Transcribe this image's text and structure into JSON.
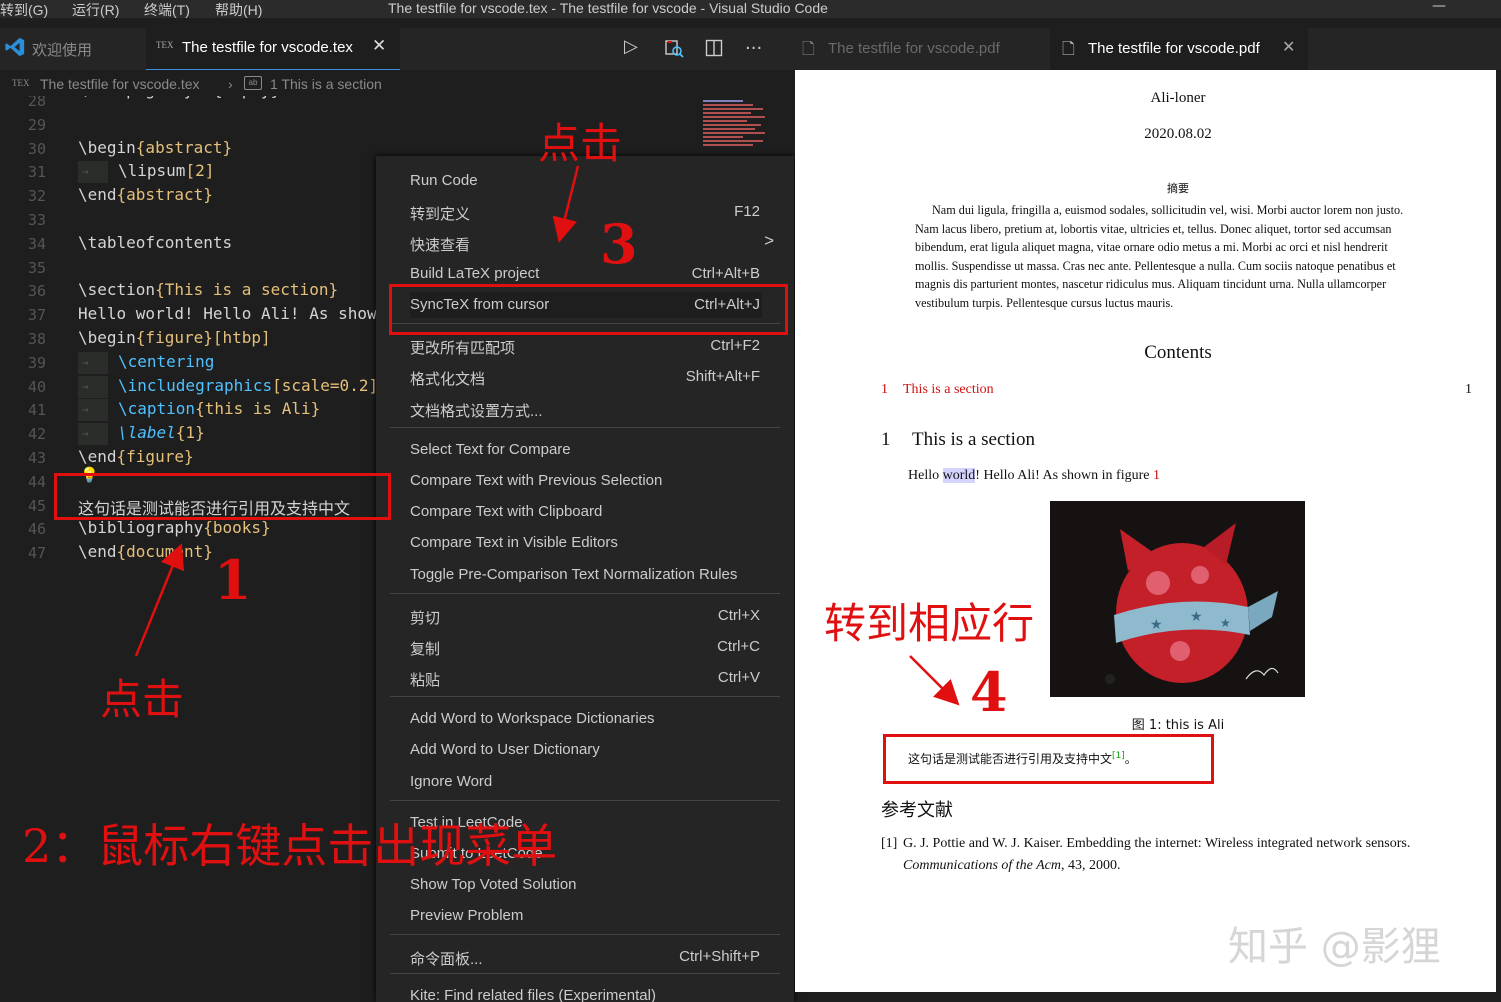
{
  "titlebar": {
    "menus": [
      "转到(G)",
      "运行(R)",
      "终端(T)",
      "帮助(H)"
    ],
    "title": "The testfile for vscode.tex - The testfile for vscode - Visual Studio Code",
    "minimize": "—"
  },
  "editor_tabs": {
    "welcome": "欢迎使用",
    "tex_badge": "TEX",
    "active_tab": "The testfile for vscode.tex",
    "close": "✕",
    "run": "▷",
    "more": "···"
  },
  "breadcrumb": {
    "file": "The testfile for vscode.tex",
    "section": "1 This is a section"
  },
  "code": {
    "lines": [
      {
        "n": "28",
        "text": "\\thispagestyle{empty}"
      },
      {
        "n": "29",
        "text": ""
      },
      {
        "n": "30",
        "cmd": "\\begin",
        "arg": "{abstract}"
      },
      {
        "n": "31",
        "cmd": "\\lipsum",
        "arg": "[2]"
      },
      {
        "n": "32",
        "cmd": "\\end",
        "arg": "{abstract}"
      },
      {
        "n": "33",
        "text": ""
      },
      {
        "n": "34",
        "cmd": "\\tableofcontents",
        "arg": ""
      },
      {
        "n": "35",
        "text": ""
      },
      {
        "n": "36",
        "cmd": "\\section",
        "arg": "{This is a section}"
      },
      {
        "n": "37",
        "text": "Hello world! Hello Ali! As show"
      },
      {
        "n": "38",
        "cmd": "\\begin",
        "arg": "{figure}[htbp]"
      },
      {
        "n": "39",
        "cmd": "\\centering",
        "arg": ""
      },
      {
        "n": "40",
        "cmd": "\\includegraphics",
        "arg": "[scale=0.2]"
      },
      {
        "n": "41",
        "cmd": "\\caption",
        "arg": "{this is Ali}"
      },
      {
        "n": "42",
        "cmd": "\\label",
        "arg": "{1}"
      },
      {
        "n": "43",
        "cmd": "\\end",
        "arg": "{figure}"
      },
      {
        "n": "44",
        "text": ""
      },
      {
        "n": "45",
        "text": "这句话是测试能否进行引用及支持中文"
      },
      {
        "n": "46",
        "cmd": "\\bibliography",
        "arg": "{books}"
      },
      {
        "n": "47",
        "cmd": "\\end",
        "arg": "{document}"
      }
    ]
  },
  "context_menu": {
    "items": [
      {
        "label": "Run Code",
        "key": ""
      },
      {
        "label": "转到定义",
        "key": "F12"
      },
      {
        "label": "快速查看",
        "key": ">"
      },
      {
        "label": "Build LaTeX project",
        "key": "Ctrl+Alt+B"
      },
      {
        "label": "SyncTeX from cursor",
        "key": "Ctrl+Alt+J"
      },
      {
        "label": "更改所有匹配项",
        "key": "Ctrl+F2"
      },
      {
        "label": "格式化文档",
        "key": "Shift+Alt+F"
      },
      {
        "label": "文档格式设置方式...",
        "key": ""
      },
      {
        "label": "Select Text for Compare",
        "key": ""
      },
      {
        "label": "Compare Text with Previous Selection",
        "key": ""
      },
      {
        "label": "Compare Text with Clipboard",
        "key": ""
      },
      {
        "label": "Compare Text in Visible Editors",
        "key": ""
      },
      {
        "label": "Toggle Pre-Comparison Text Normalization Rules",
        "key": ""
      },
      {
        "label": "剪切",
        "key": "Ctrl+X"
      },
      {
        "label": "复制",
        "key": "Ctrl+C"
      },
      {
        "label": "粘贴",
        "key": "Ctrl+V"
      },
      {
        "label": "Add Word to Workspace Dictionaries",
        "key": ""
      },
      {
        "label": "Add Word to User Dictionary",
        "key": ""
      },
      {
        "label": "Ignore Word",
        "key": ""
      },
      {
        "label": "Test in LeetCode",
        "key": ""
      },
      {
        "label": "Submit to LeetCode",
        "key": ""
      },
      {
        "label": "Show Top Voted Solution",
        "key": ""
      },
      {
        "label": "Preview Problem",
        "key": ""
      },
      {
        "label": "命令面板...",
        "key": "Ctrl+Shift+P"
      },
      {
        "label": "Kite: Find related files (Experimental)",
        "key": ""
      }
    ]
  },
  "pdf_tabs": {
    "inactive": "The testfile for vscode.pdf",
    "active": "The testfile for vscode.pdf",
    "close": "✕"
  },
  "pdf": {
    "author": "Ali-loner",
    "date": "2020.08.02",
    "abstract_title": "摘要",
    "abstract_lines": [
      "Nam dui ligula, fringilla a, euismod sodales, sollicitudin vel, wisi. Morbi auctor lorem non justo.",
      "Nam lacus libero, pretium at, lobortis vitae, ultricies et, tellus. Donec aliquet, tortor sed accumsan",
      "bibendum, erat ligula aliquet magna, vitae ornare odio metus a mi. Morbi ac orci et nisl hendrerit",
      "mollis. Suspendisse ut massa. Cras nec ante. Pellentesque a nulla. Cum sociis natoque penatibus et",
      "magnis dis parturient montes, nascetur ridiculus mus. Aliquam tincidunt urna. Nulla ullamcorper",
      "vestibulum turpis. Pellentesque cursus luctus mauris."
    ],
    "contents_title": "Contents",
    "toc_num": "1",
    "toc_entry": "This is a section",
    "toc_page": "1",
    "section_num": "1",
    "section_title": "This is a section",
    "body_pre": "Hello ",
    "body_word": "world",
    "body_post": "! Hello Ali! As shown in figure ",
    "body_ref": "1",
    "figure_caption": "图 1: this is Ali",
    "chinese_sentence": "这句话是测试能否进行引用及支持中文",
    "cite": "[1]",
    "cite_end": "。",
    "refs_title": "参考文献",
    "ref_label": "[1]",
    "ref_text": "G. J. Pottie and W. J. Kaiser. Embedding the internet: Wireless integrated network sensors.",
    "ref_journal": "Communications of the Acm",
    "ref_tail": ", 43, 2000."
  },
  "annotations": {
    "click_top": "点击",
    "num3": "3",
    "num1": "1",
    "click_bottom": "点击",
    "step2": "2：鼠标右键点击出现菜单",
    "goto_line": "转到相应行",
    "num4": "4",
    "watermark": "知乎 @影狸"
  },
  "colors": {
    "accent_red": "#e01010",
    "editor_bg": "#1e1e1e",
    "menu_bg": "#252526",
    "keyword_blue": "#4fc1ff",
    "brace_yellow": "#e5c07b"
  }
}
